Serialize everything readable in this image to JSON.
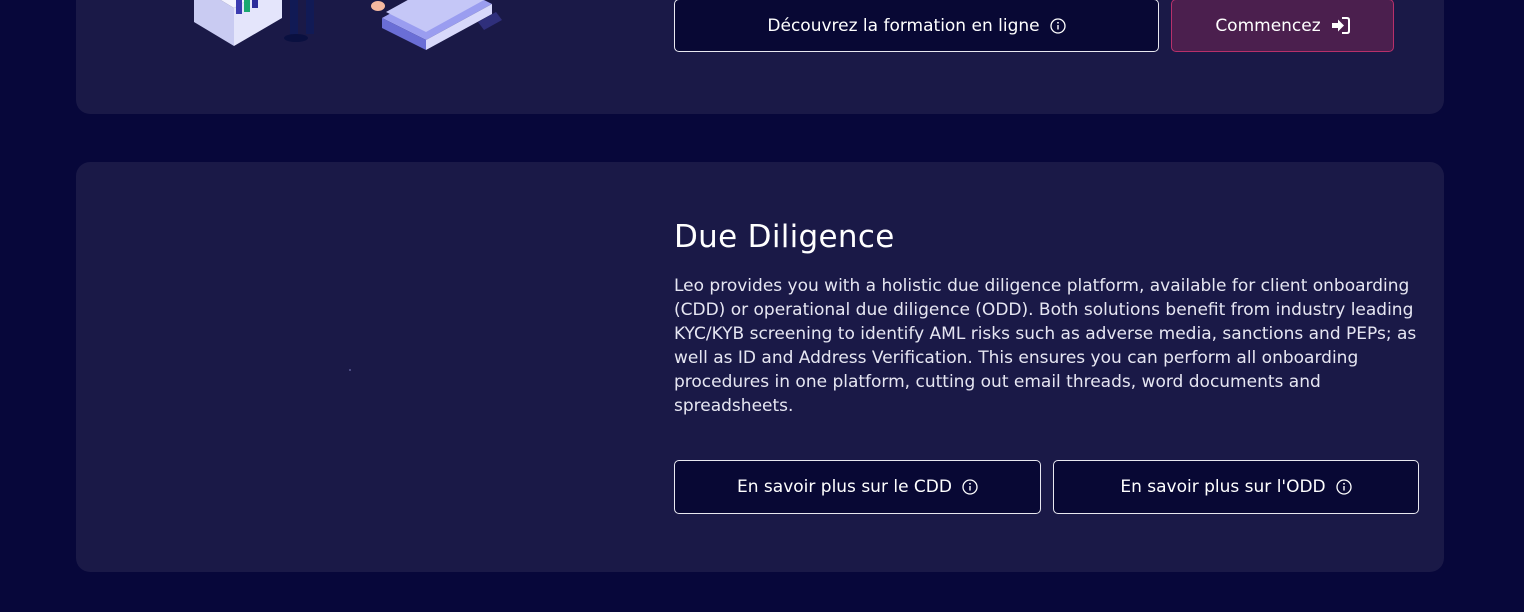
{
  "colors": {
    "page_background": "#07073a",
    "card_background": "#1a1947",
    "button_outline_bg": "#080834",
    "button_start_bg": "#4b1f4e",
    "button_start_border": "#b8306a"
  },
  "top_section": {
    "discover_button": {
      "label": "Découvrez la formation en ligne",
      "icon": "info-circle-icon"
    },
    "start_button": {
      "label": "Commencez",
      "icon": "sign-in-icon"
    }
  },
  "due_diligence": {
    "title": "Due Diligence",
    "description": "Leo provides you with a holistic due diligence platform, available for client onboarding (CDD) or operational due diligence (ODD). Both solutions benefit from industry leading KYC/KYB screening to identify AML risks such as adverse media, sanctions and PEPs; as well as ID and Address Verification. This ensures you can perform all onboarding procedures in one platform, cutting out email threads, word documents and spreadsheets.",
    "cdd_button": {
      "label": "En savoir plus sur le CDD",
      "icon": "info-circle-icon"
    },
    "odd_button": {
      "label": "En savoir plus sur l'ODD",
      "icon": "info-circle-icon"
    }
  }
}
